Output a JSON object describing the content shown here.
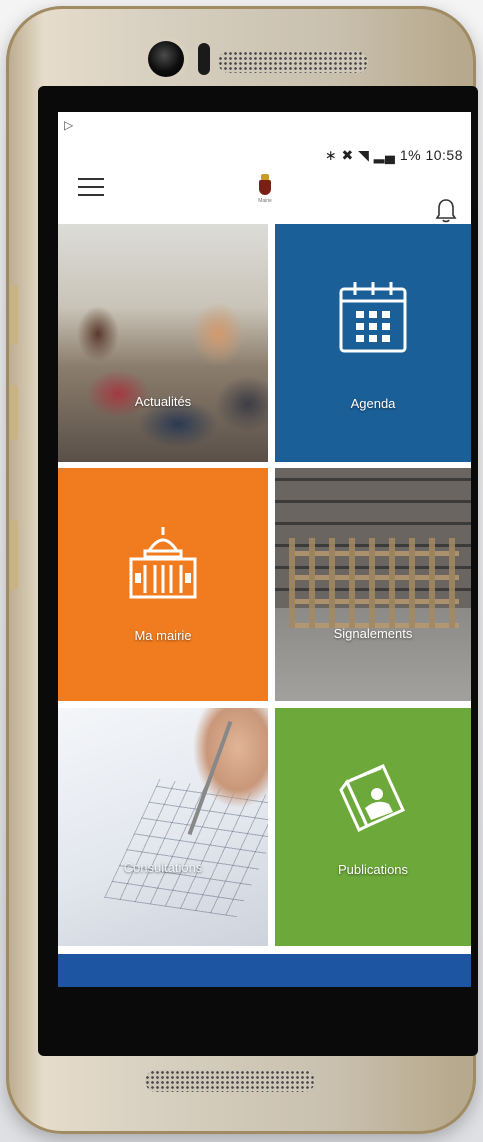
{
  "status_bar": {
    "notification_icon": "play-store-icon",
    "right_text": "1% 10:58",
    "icons": [
      "bluetooth-icon",
      "mute-icon",
      "wifi-icon",
      "signal-icon",
      "battery-icon"
    ]
  },
  "app_bar": {
    "menu_icon": "hamburger-icon",
    "logo_caption": "Mairie",
    "bell_icon": "bell-icon"
  },
  "tiles": [
    {
      "label": "Actualités",
      "icon": "photo-students"
    },
    {
      "label": "Agenda",
      "icon": "calendar-icon",
      "color": "#1a5f98"
    },
    {
      "label": "Ma mairie",
      "icon": "townhall-icon",
      "color": "#f07c1f"
    },
    {
      "label": "Signalements",
      "icon": "photo-chairs"
    },
    {
      "label": "Consultations",
      "icon": "photo-ballot"
    },
    {
      "label": "Publications",
      "icon": "magazine-icon",
      "color": "#6da83b"
    }
  ],
  "accent_strip_color": "#1d55a3"
}
